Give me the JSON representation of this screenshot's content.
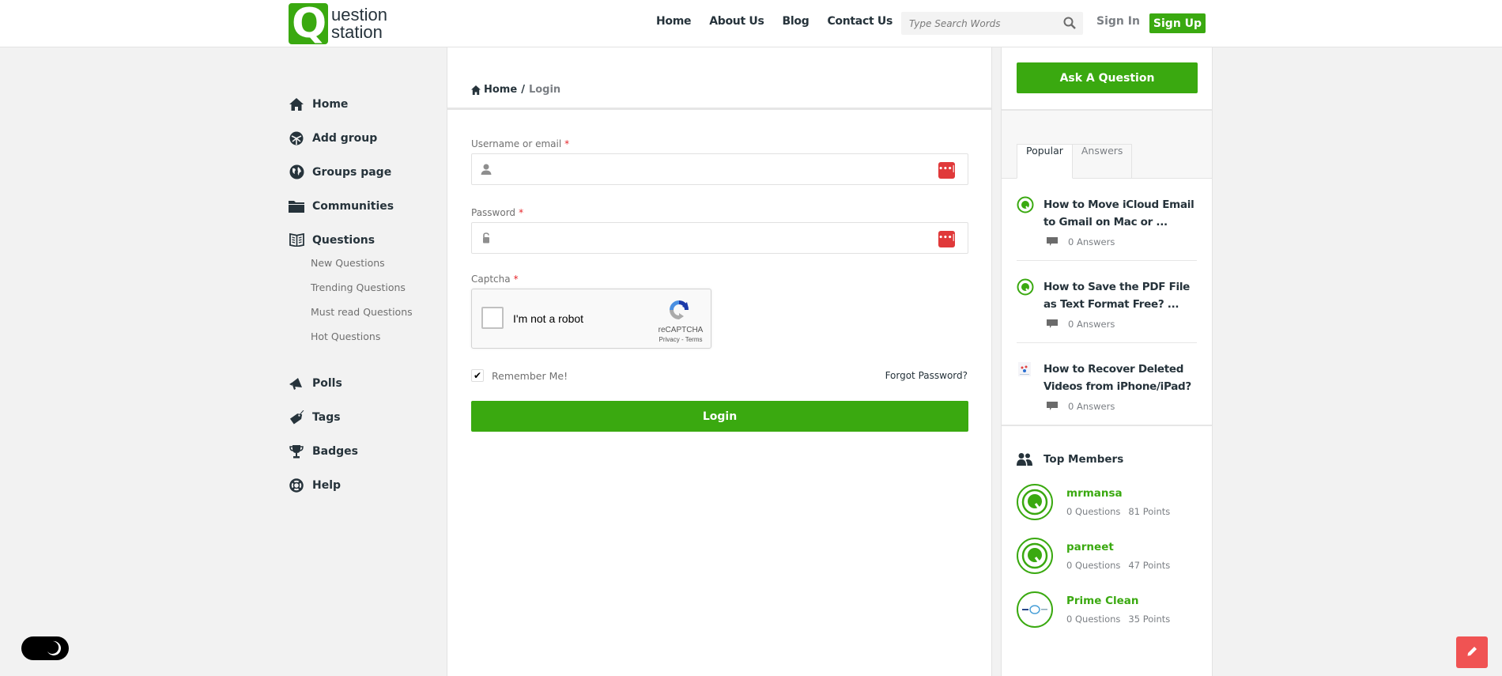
{
  "header": {
    "logo_line1": "uestion",
    "logo_line2": "station",
    "logo_letter": "Q",
    "nav": [
      "Home",
      "About Us",
      "Blog",
      "Contact Us"
    ],
    "search_placeholder": "Type Search Words",
    "sign_in": "Sign In",
    "sign_up": "Sign Up"
  },
  "left_sidebar": {
    "items": [
      {
        "label": "Home",
        "icon": "home-icon"
      },
      {
        "label": "Add group",
        "icon": "group-add-icon"
      },
      {
        "label": "Groups page",
        "icon": "globe-icon"
      },
      {
        "label": "Communities",
        "icon": "folder-icon"
      },
      {
        "label": "Questions",
        "icon": "book-icon"
      }
    ],
    "question_sub": [
      "New Questions",
      "Trending Questions",
      "Must read Questions",
      "Hot Questions"
    ],
    "items2": [
      {
        "label": "Polls",
        "icon": "megaphone-icon"
      },
      {
        "label": "Tags",
        "icon": "tag-icon"
      },
      {
        "label": "Badges",
        "icon": "trophy-icon"
      },
      {
        "label": "Help",
        "icon": "lifebuoy-icon"
      }
    ]
  },
  "breadcrumb": {
    "home": "Home",
    "separator": "/",
    "current": "Login"
  },
  "login_form": {
    "username_label": "Username or email",
    "username_value": "",
    "password_label": "Password",
    "password_value": "",
    "required_mark": "*",
    "captcha_label": "Captcha",
    "recaptcha_text": "I'm not a robot",
    "recaptcha_brand": "reCAPTCHA",
    "recaptcha_links": "Privacy - Terms",
    "remember_label": "Remember Me!",
    "remember_checked": true,
    "forgot_password": "Forgot Password?",
    "login_button": "Login",
    "password_manager_glyph": "•••|"
  },
  "right_sidebar": {
    "ask_button": "Ask A Question",
    "tabs": [
      {
        "label": "Popular",
        "active": true
      },
      {
        "label": "Answers",
        "active": false
      }
    ],
    "popular": [
      {
        "title": "How to Move iCloud Email to Gmail on Mac or ...",
        "answers": "0 Answers"
      },
      {
        "title": "How to Save the PDF File as Text Format Free? ...",
        "answers": "0 Answers"
      },
      {
        "title": "How to Recover Deleted Videos from iPhone/iPad?",
        "answers": "0 Answers"
      }
    ],
    "top_members_title": "Top Members",
    "members": [
      {
        "name": "mrmansa",
        "questions": "0 Questions",
        "points": "81 Points"
      },
      {
        "name": "parneet",
        "questions": "0 Questions",
        "points": "47 Points"
      },
      {
        "name": "Prime Clean",
        "questions": "0 Questions",
        "points": "35 Points"
      }
    ]
  },
  "colors": {
    "brand_green": "#3aa910",
    "text_dark": "#26333b",
    "muted": "#7b7f84",
    "fab_red": "#f05353",
    "pw_manager_red": "#e0393a"
  }
}
